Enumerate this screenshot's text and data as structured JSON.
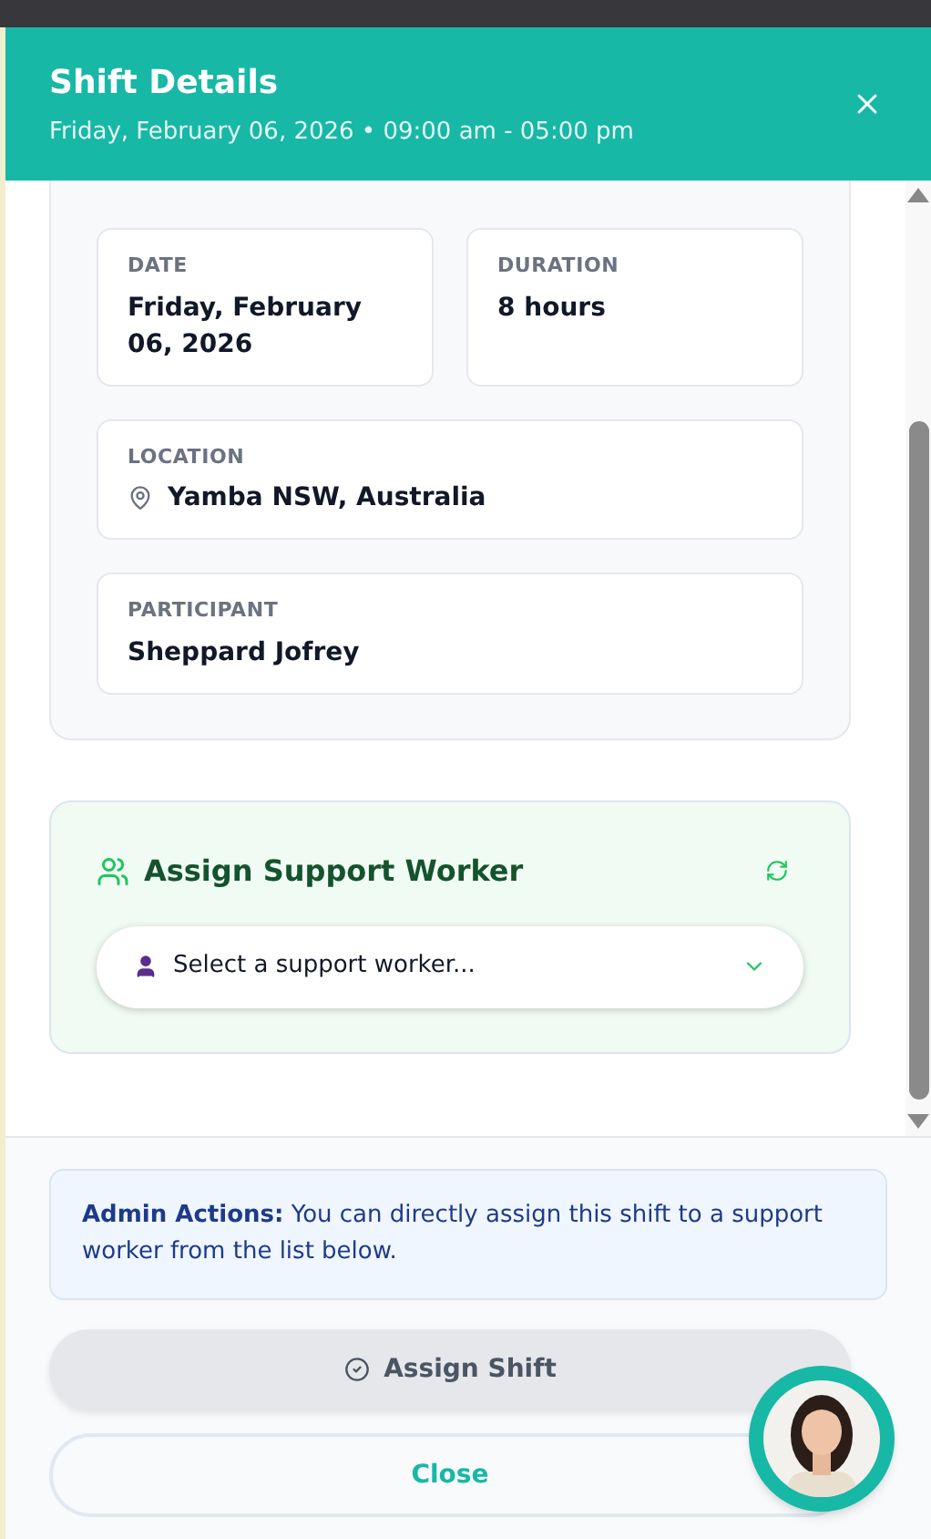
{
  "header": {
    "title": "Shift Details",
    "subtitle": "Friday, February 06, 2026 • 09:00 am - 05:00 pm"
  },
  "info_fields": [
    {
      "kind": "half",
      "label": "DATE",
      "value": "Friday, February 06, 2026"
    },
    {
      "kind": "half",
      "label": "DURATION",
      "value": "8 hours"
    },
    {
      "kind": "location",
      "label": "LOCATION",
      "value": "Yamba NSW, Australia"
    },
    {
      "kind": "full",
      "label": "PARTICIPANT",
      "value": "Sheppard Jofrey"
    }
  ],
  "assign": {
    "title": "Assign Support Worker",
    "placeholder": "Select a support worker..."
  },
  "admin_note": "**Admin Actions:** You can directly assign this shift to a support worker from the list below.",
  "buttons": [
    {
      "kind": "primary",
      "label": "Assign Shift",
      "disabled": true
    },
    {
      "kind": "secondary",
      "label": "Close",
      "disabled": false
    }
  ]
}
